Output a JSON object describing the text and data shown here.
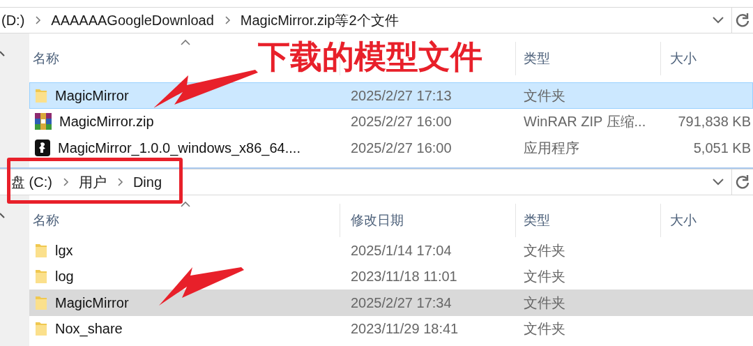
{
  "panes": [
    {
      "focused": true,
      "breadcrumb": [
        "(D:)",
        "AAAAAAGoogleDownload",
        "MagicMirror.zip等2个文件"
      ],
      "columns": [
        {
          "kind": "name",
          "label": "名称"
        },
        {
          "kind": "type",
          "label": "类型"
        },
        {
          "kind": "size",
          "label": "大小"
        }
      ],
      "rows": [
        {
          "kind": "folder",
          "name": "MagicMirror",
          "modified": "2025/2/27 17:13",
          "type": "文件夹",
          "selected": true
        },
        {
          "kind": "archive",
          "name": "MagicMirror.zip",
          "modified": "2025/2/27 16:00",
          "type": "WinRAR ZIP 压缩...",
          "size": "791,838 KB",
          "selected": false
        },
        {
          "kind": "app",
          "name": "MagicMirror_1.0.0_windows_x86_64....",
          "modified": "2025/2/27 16:00",
          "type": "应用程序",
          "size": "5,051 KB",
          "selected": false
        }
      ]
    },
    {
      "focused": false,
      "breadcrumb": [
        "盘 (C:)",
        "用户",
        "Ding"
      ],
      "columns": [
        {
          "kind": "name",
          "label": "名称"
        },
        {
          "kind": "date",
          "label": "修改日期"
        },
        {
          "kind": "type",
          "label": "类型"
        },
        {
          "kind": "size",
          "label": "大小"
        }
      ],
      "rows": [
        {
          "kind": "folder",
          "name": "lgx",
          "modified": "2025/1/14 17:04",
          "type": "文件夹",
          "selected": false
        },
        {
          "kind": "folder",
          "name": "log",
          "modified": "2023/11/18 11:01",
          "type": "文件夹",
          "selected": false
        },
        {
          "kind": "folder",
          "name": "MagicMirror",
          "modified": "2025/2/27 17:34",
          "type": "文件夹",
          "selected": true
        },
        {
          "kind": "folder",
          "name": "Nox_share",
          "modified": "2023/11/29 18:41",
          "type": "文件夹",
          "selected": false
        }
      ]
    }
  ],
  "annotations": [
    {
      "kind": "label",
      "text": "下载的模型文件"
    },
    {
      "kind": "arrow"
    },
    {
      "kind": "box"
    },
    {
      "kind": "arrow"
    }
  ]
}
